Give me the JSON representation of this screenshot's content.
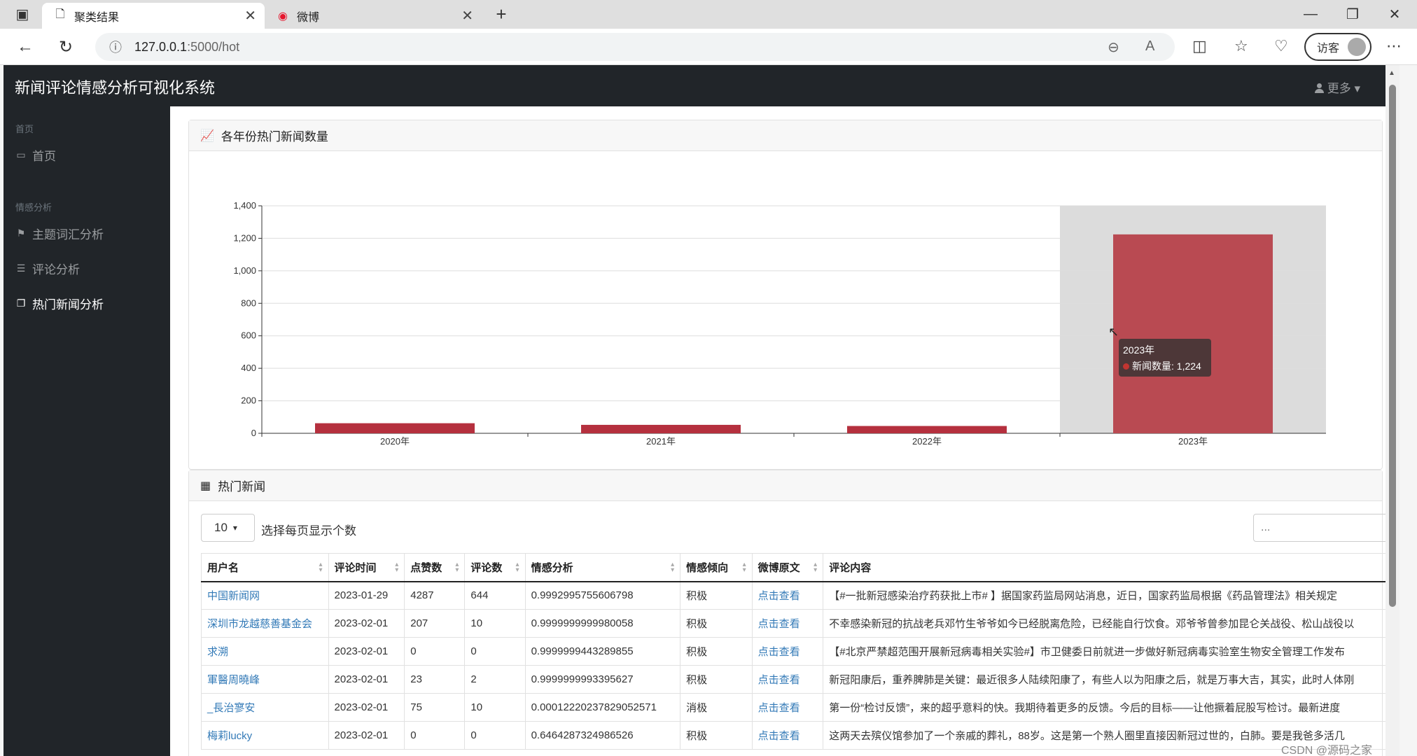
{
  "browser": {
    "tabs": [
      {
        "title": "聚类结果",
        "icon": "page-icon"
      },
      {
        "title": "微博",
        "icon": "weibo-icon"
      }
    ],
    "url_host": "127.0.0.1",
    "url_path": ":5000/hot",
    "guest_label": "访客"
  },
  "app": {
    "brand": "新闻评论情感分析可视化系统",
    "more_label": "更多",
    "sidebar": {
      "section_home": "首页",
      "item_home": "首页",
      "section_analysis": "情感分析",
      "items": [
        {
          "label": "主题词汇分析",
          "icon": "flag-icon"
        },
        {
          "label": "评论分析",
          "icon": "list-icon"
        },
        {
          "label": "热门新闻分析",
          "icon": "copy-icon"
        }
      ]
    }
  },
  "chart_card": {
    "title": "各年份热门新闻数量"
  },
  "chart_data": {
    "type": "bar",
    "categories": [
      "2020年",
      "2021年",
      "2022年",
      "2023年"
    ],
    "series": [
      {
        "name": "新闻数量",
        "values": [
          62,
          52,
          45,
          1224
        ]
      }
    ],
    "ylim": [
      0,
      1400
    ],
    "yticks": [
      "0",
      "200",
      "400",
      "600",
      "800",
      "1,000",
      "1,200",
      "1,400"
    ],
    "grid": true,
    "color": "#c23531",
    "tooltip": {
      "category": "2023年",
      "label": "新闻数量",
      "value": "1,224"
    }
  },
  "table_card": {
    "title": "热门新闻",
    "page_size": "10",
    "page_size_label": "选择每页显示个数",
    "search_placeholder": "...",
    "columns": [
      "用户名",
      "评论时间",
      "点赞数",
      "评论数",
      "情感分析",
      "情感倾向",
      "微博原文",
      "评论内容"
    ],
    "rows": [
      [
        "中国新闻网",
        "2023-01-29",
        "4287",
        "644",
        "0.9992995755606798",
        "积极",
        "点击查看",
        "【#一批新冠感染治疗药获批上市# 】据国家药监局网站消息，近日，国家药监局根据《药品管理法》相关规定"
      ],
      [
        "深圳市龙越慈善基金会",
        "2023-02-01",
        "207",
        "10",
        "0.9999999999980058",
        "积极",
        "点击查看",
        "不幸感染新冠的抗战老兵邓竹生爷爷如今已经脱离危险，已经能自行饮食。邓爷爷曾参加昆仑关战役、松山战役以"
      ],
      [
        "求溯",
        "2023-02-01",
        "0",
        "0",
        "0.9999999443289855",
        "积极",
        "点击查看",
        "【#北京严禁超范围开展新冠病毒相关实验#】市卫健委日前就进一步做好新冠病毒实验室生物安全管理工作发布"
      ],
      [
        "軍醫周曉峰",
        "2023-02-01",
        "23",
        "2",
        "0.9999999993395627",
        "积极",
        "点击查看",
        "新冠阳康后，重养脾肺是关键：最近很多人陆续阳康了，有些人以为阳康之后，就是万事大吉，其实，此时人体刚"
      ],
      [
        "_長治寥安",
        "2023-02-01",
        "75",
        "10",
        "0.00012220237829052571",
        "消极",
        "点击查看",
        "第一份“检讨反馈”，来的超乎意料的快。我期待着更多的反馈。今后的目标——让他撅着屁股写检讨。最新进度"
      ],
      [
        "梅莉lucky",
        "2023-02-01",
        "0",
        "0",
        "0.6464287324986526",
        "积极",
        "点击查看",
        "这两天去殡仪馆参加了一个亲戚的葬礼，88岁。这是第一个熟人圈里直接因新冠过世的，白肺。要是我爸多活几"
      ]
    ]
  },
  "watermark": "CSDN @源码之家"
}
